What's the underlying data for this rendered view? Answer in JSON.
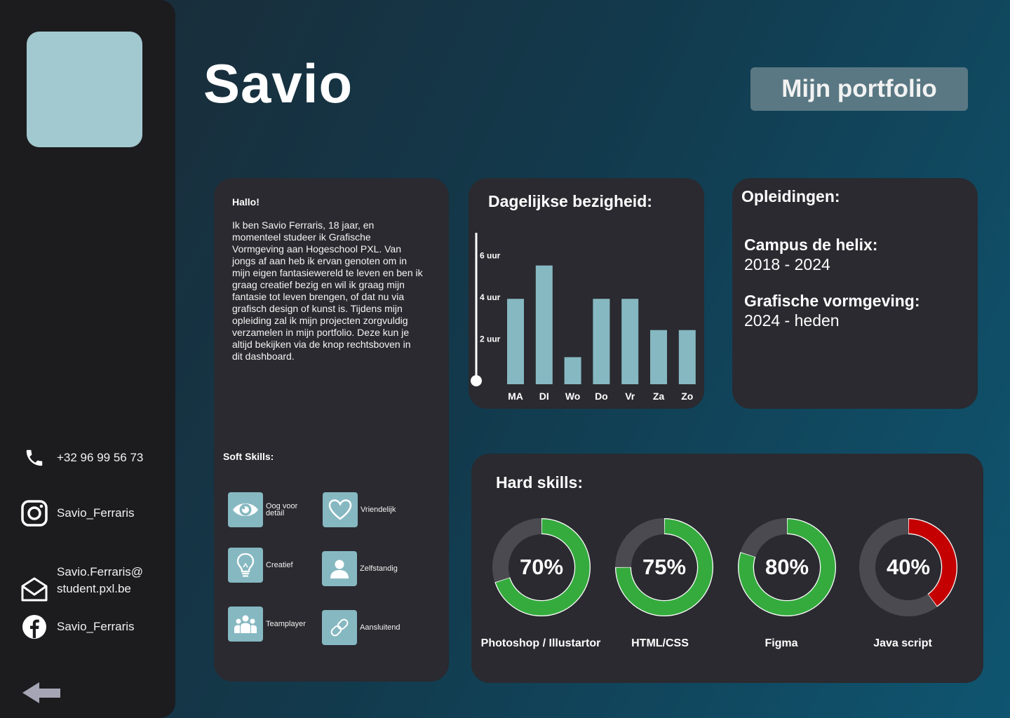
{
  "profile": {
    "name": "Savio"
  },
  "header": {
    "portfolio_button": "Mijn portfolio"
  },
  "contact": {
    "phone": "+32 96 99 56 73",
    "instagram": "Savio_Ferraris",
    "email_line1": "Savio.Ferraris@",
    "email_line2": "student.pxl.be",
    "facebook": "Savio_Ferraris"
  },
  "about": {
    "greeting": "Hallo!",
    "bio": "Ik ben Savio Ferraris, 18 jaar, en momenteel studeer ik Grafische Vormgeving aan Hogeschool PXL. Van jongs af aan heb ik ervan genoten om in mijn eigen fantasiewereld te leven en ben ik graag creatief bezig en wil ik graag mijn fantasie tot leven brengen, of dat nu via grafisch design of kunst is. Tijdens mijn opleiding zal ik mijn projecten zorgvuldig verzamelen in mijn portfolio. Deze kun je altijd bekijken via de knop rechtsboven in dit dashboard."
  },
  "soft_skills": {
    "title": "Soft Skills:",
    "items": [
      {
        "label": "Oog voor detail",
        "icon": "eye-icon"
      },
      {
        "label": "Vriendelijk",
        "icon": "heart-icon"
      },
      {
        "label": "Creatief",
        "icon": "lightbulb-icon"
      },
      {
        "label": "Zelfstandig",
        "icon": "person-icon"
      },
      {
        "label": "Teamplayer",
        "icon": "team-icon"
      },
      {
        "label": "Aansluitend",
        "icon": "link-icon"
      }
    ]
  },
  "daily": {
    "title": "Dagelijkse bezigheid:"
  },
  "education": {
    "title": "Opleidingen:",
    "items": [
      {
        "name": "Campus de helix:",
        "years": "2018 - 2024"
      },
      {
        "name": "Grafische vormgeving:",
        "years": "2024 - heden"
      }
    ]
  },
  "hard_skills": {
    "title": "Hard skills:",
    "items": [
      {
        "label": "Photoshop / Illustartor",
        "percent": 70,
        "display": "70%",
        "color": "#35ab3e"
      },
      {
        "label": "HTML/CSS",
        "percent": 75,
        "display": "75%",
        "color": "#35ab3e"
      },
      {
        "label": "Figma",
        "percent": 80,
        "display": "80%",
        "color": "#35ab3e"
      },
      {
        "label": "Java script",
        "percent": 40,
        "display": "40%",
        "color": "#c40000"
      }
    ]
  },
  "colors": {
    "accent": "#86b8c1",
    "card": "#2a2a30",
    "sidebar": "#1c1c1f",
    "track": "#4a4a50"
  },
  "chart_data": {
    "type": "bar",
    "title": "Dagelijkse bezigheid:",
    "categories": [
      "MA",
      "DI",
      "Wo",
      "Do",
      "Vr",
      "Za",
      "Zo"
    ],
    "values": [
      4.1,
      5.7,
      1.3,
      4.1,
      4.1,
      2.6,
      2.6
    ],
    "y_ticks": [
      {
        "value": 2,
        "label": "2 uur"
      },
      {
        "value": 4,
        "label": "4 uur"
      },
      {
        "value": 6,
        "label": "6 uur"
      }
    ],
    "ylim": [
      0,
      7
    ],
    "grid": false,
    "bar_color": "#86b8c1"
  }
}
